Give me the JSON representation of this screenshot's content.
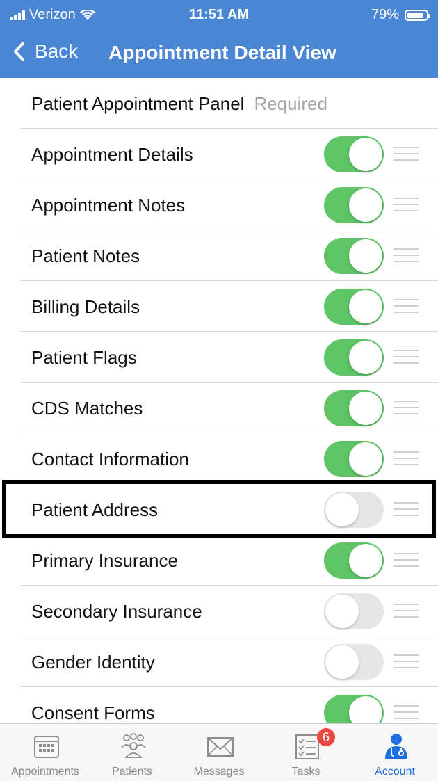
{
  "status_bar": {
    "carrier": "Verizon",
    "time": "11:51 AM",
    "battery": "79%"
  },
  "nav": {
    "back_label": "Back",
    "title": "Appointment Detail View"
  },
  "header_row": {
    "label": "Patient Appointment Panel",
    "note": "Required"
  },
  "rows": [
    {
      "label": "Appointment Details",
      "enabled": true
    },
    {
      "label": "Appointment Notes",
      "enabled": true
    },
    {
      "label": "Patient Notes",
      "enabled": true
    },
    {
      "label": "Billing Details",
      "enabled": true
    },
    {
      "label": "Patient Flags",
      "enabled": true
    },
    {
      "label": "CDS Matches",
      "enabled": true
    },
    {
      "label": "Contact Information",
      "enabled": true
    },
    {
      "label": "Patient Address",
      "enabled": false,
      "highlighted": true
    },
    {
      "label": "Primary Insurance",
      "enabled": true
    },
    {
      "label": "Secondary Insurance",
      "enabled": false
    },
    {
      "label": "Gender Identity",
      "enabled": false
    },
    {
      "label": "Consent Forms",
      "enabled": true
    }
  ],
  "tabs": [
    {
      "label": "Appointments",
      "icon": "calendar-icon"
    },
    {
      "label": "Patients",
      "icon": "patients-icon"
    },
    {
      "label": "Messages",
      "icon": "envelope-icon"
    },
    {
      "label": "Tasks",
      "icon": "checklist-icon",
      "badge": "6"
    },
    {
      "label": "Account",
      "icon": "doctor-icon",
      "active": true
    }
  ],
  "colors": {
    "header": "#4a86d3",
    "toggle_on": "#5ec466",
    "toggle_off": "#e6e6e6",
    "active_tab": "#1f6fe0",
    "badge": "#e9473f"
  }
}
